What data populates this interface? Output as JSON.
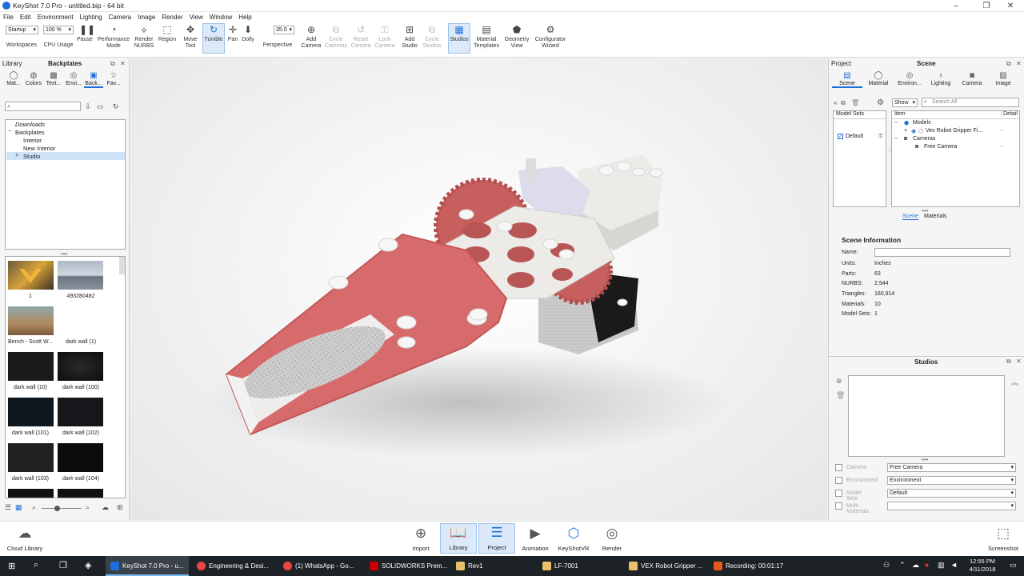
{
  "titlebar": {
    "title": "KeyShot 7.0 Pro  -  untitled.bip  -  64 bit",
    "minimize": "–",
    "maximize": "❐",
    "close": "✕"
  },
  "menu": [
    "File",
    "Edit",
    "Environment",
    "Lighting",
    "Camera",
    "Image",
    "Render",
    "View",
    "Window",
    "Help"
  ],
  "toolbar": {
    "workspace_select": "Startup",
    "cpu_select": "100 %",
    "workspaces": "Workspaces",
    "cpu_usage": "CPU Usage",
    "pause": "Pause",
    "performance_mode": "Performance Mode",
    "render_nurbs": "Render NURBS",
    "region": "Region",
    "move_tool": "Move Tool",
    "tumble": "Tumble",
    "pan": "Pan",
    "dolly": "Dolly",
    "focal_value": "35.0",
    "perspective": "Perspective",
    "add_camera": "Add Camera",
    "cycle_cameras": "Cycle Cameras",
    "reset_camera": "Reset Camera",
    "lock_camera": "Lock Camera",
    "add_studio": "Add Studio",
    "cycle_studios": "Cycle Studios",
    "studios": "Studios",
    "material_templates": "Material Templates",
    "geometry_view": "Geometry View",
    "configurator_wizard": "Configurator Wizard"
  },
  "library": {
    "header_left": "Library",
    "header_title": "Backplates",
    "tabs": [
      "Mat...",
      "Colors",
      "Text...",
      "Envi...",
      "Back...",
      "Fav..."
    ],
    "tree": {
      "downloads": "Downloads",
      "backplates": "Backplates",
      "interior": "Interior",
      "new_interior": "New Interior",
      "studio": "Studio"
    },
    "thumbs": [
      "1",
      "493280482",
      "Bench - Scott W...",
      "dark wall (1)",
      "dark wall (10)",
      "dark wall (100)",
      "dark wall (101)",
      "dark wall (102)",
      "dark wall (103)",
      "dark wall (104)"
    ]
  },
  "project": {
    "header_left": "Project",
    "header_title": "Scene",
    "tabs": [
      "Scene",
      "Material",
      "Environ...",
      "Lighting",
      "Camera",
      "Image"
    ],
    "show_select": "Show",
    "search_placeholder": "Search All",
    "model_sets_header": "Model Sets",
    "model_set_default": "Default",
    "item_header": "Item",
    "detail_header": "Detail",
    "tree": {
      "models": "Models",
      "vex": "Vex Robot Gripper Fi...",
      "cameras": "Cameras",
      "free_camera": "Free Camera",
      "dash": "-"
    },
    "subtabs": [
      "Scene",
      "Materials"
    ],
    "scene_info": {
      "title": "Scene Information",
      "name_label": "Name:",
      "units_label": "Units:",
      "units": "Inches",
      "parts_label": "Parts:",
      "parts": "63",
      "nurbs_label": "NURBS:",
      "nurbs": "2,944",
      "triangles_label": "Triangles:",
      "triangles": "160,914",
      "materials_label": "Materials:",
      "materials": "10",
      "model_sets_label": "Model Sets:",
      "model_sets": "1"
    }
  },
  "studios": {
    "title": "Studios",
    "rows": [
      {
        "label": "Camera",
        "value": "Free Camera"
      },
      {
        "label": "Environment",
        "value": "Environment"
      },
      {
        "label": "Model Sets",
        "value": "Default"
      },
      {
        "label": "Multi-Materials",
        "value": ""
      }
    ]
  },
  "bottombar": {
    "cloud_library": "Cloud Library",
    "import": "Import",
    "library": "Library",
    "project": "Project",
    "animation": "Animation",
    "keyshotvr": "KeyShotVR",
    "render": "Render",
    "screenshot": "Screenshot"
  },
  "taskbar": {
    "tasks": [
      "KeyShot 7.0 Pro - u...",
      "Engineering & Desi...",
      "(1) WhatsApp - Go...",
      "SOLIDWORKS Prem...",
      "Rev1",
      "LF-7001",
      "VEX Robot Gripper ...",
      "Recording: 00:01:17"
    ],
    "time": "12:55 PM",
    "date": "4/11/2018"
  },
  "colors": {
    "accent": "#1e6fd9",
    "selection": "#cfe3f7",
    "gripper": "#d76a6a",
    "plate": "#e9e6e2"
  }
}
